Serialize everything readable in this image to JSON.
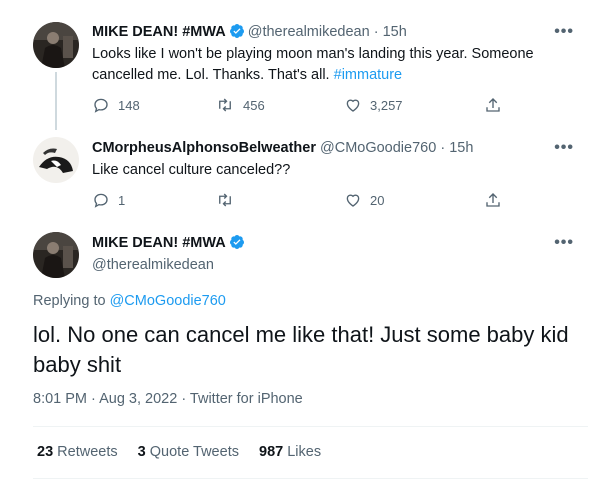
{
  "tweet1": {
    "name": "MIKE DEAN! #MWA",
    "handle": "@therealmikedean",
    "dot": "·",
    "time": "15h",
    "text": "Looks like I won't be playing moon man's landing this year. Someone cancelled me. Lol. Thanks. That's all.",
    "hashtag": "#immature",
    "replies": "148",
    "retweets": "456",
    "likes": "3,257"
  },
  "tweet2": {
    "name": "CMorpheusAlphonsoBelweather",
    "handle": "@CMoGoodie760",
    "dot": "·",
    "time": "15h",
    "text": "Like cancel culture canceled??",
    "replies": "1",
    "retweets": "",
    "likes": "20"
  },
  "main_tweet": {
    "name": "MIKE DEAN! #MWA",
    "handle": "@therealmikedean",
    "replying_label": "Replying to",
    "replying_to": "@CMoGoodie760",
    "text": "lol. No one can cancel me like that!  Just some baby kid baby shit",
    "timestamp": "8:01 PM · Aug 3, 2022 · Twitter for iPhone",
    "retweets_count": "23",
    "retweets_label": "Retweets",
    "quotes_count": "3",
    "quotes_label": "Quote Tweets",
    "likes_count": "987",
    "likes_label": "Likes"
  },
  "more_glyph": "•••",
  "colors": {
    "accent": "#1d9bf0",
    "muted": "#536471",
    "line": "#cfd9de"
  }
}
